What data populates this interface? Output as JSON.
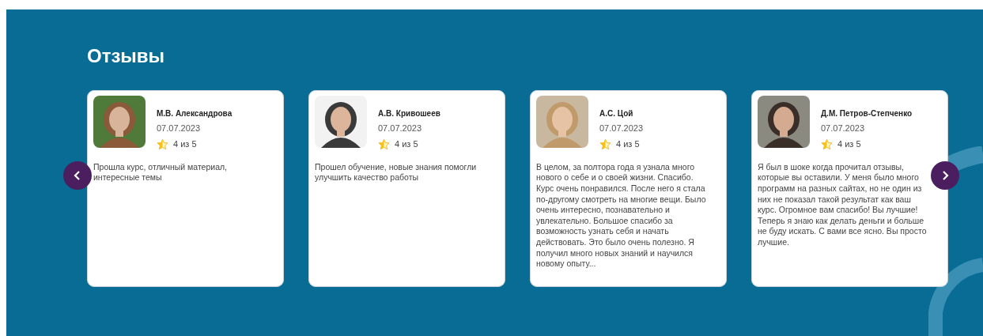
{
  "section": {
    "title": "Отзывы"
  },
  "reviews": [
    {
      "name": "М.В. Александрова",
      "date": "07.07.2023",
      "rating": "4 из 5",
      "text": "Прошла курс, отличный материал, интересные темы"
    },
    {
      "name": "А.В. Кривошеев",
      "date": "07.07.2023",
      "rating": "4 из 5",
      "text": "Прошел обучение, новые знания помогли улучшить качество работы"
    },
    {
      "name": "А.С. Цой",
      "date": "07.07.2023",
      "rating": "4 из 5",
      "text": "В целом, за полтора года я узнала много нового о себе и о своей жизни. Спасибо. Курс очень понравился. После него я стала по-другому смотреть на многие вещи. Было очень интересно, познавательно и увлекательно. Большое спасибо за возможность узнать себя и начать действовать. Это было очень полезно. Я получил много новых знаний и научился новому опыту..."
    },
    {
      "name": "Д.М. Петров-Степченко",
      "date": "07.07.2023",
      "rating": "4 из 5",
      "text": "Я был в шоке когда прочитал отзывы, которые вы оставили. У меня было много программ на разных сайтах, но не один из них не показал такой результат как ваш курс. Огромное вам спасибо! Вы лучшие! Теперь я знаю как делать деньги и больше не буду искать. С вами все ясно. Вы просто лучшие."
    }
  ]
}
